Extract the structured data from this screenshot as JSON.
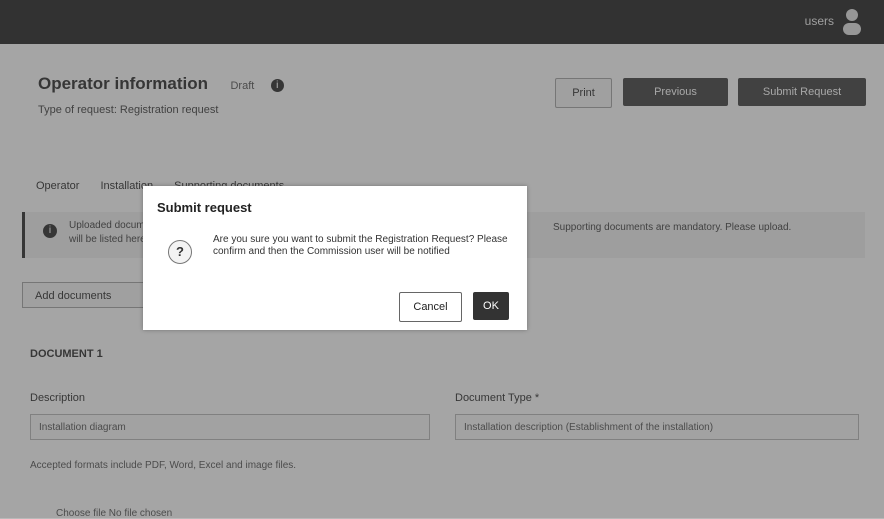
{
  "header": {
    "user": "users",
    "user_icon": "user-icon"
  },
  "page": {
    "title": "Operator information",
    "status": "Draft",
    "subtitle": "Type of request: Registration request",
    "buttons": {
      "print": "Print",
      "previous": "Previous",
      "submit": "Submit Request"
    },
    "tabs": [
      "Operator",
      "Installation",
      "Supporting documents"
    ],
    "alert": {
      "line1": "Uploaded documents",
      "line2": "will be listed here",
      "right": "Supporting documents are mandatory. Please upload."
    },
    "add_documents": "Add documents",
    "document": {
      "title": "DOCUMENT 1",
      "description_label": "Description",
      "description_value": "Installation diagram",
      "type_label": "Document Type *",
      "type_value": "Installation description (Establishment of the installation)"
    },
    "note": "Accepted formats include PDF, Word, Excel and image files.",
    "upload": "Choose file   No file chosen"
  },
  "modal": {
    "title": "Submit request",
    "message": "Are you sure you want to submit the Registration Request? Please confirm and then the Commission user will be notified",
    "cancel": "Cancel",
    "ok": "OK"
  }
}
